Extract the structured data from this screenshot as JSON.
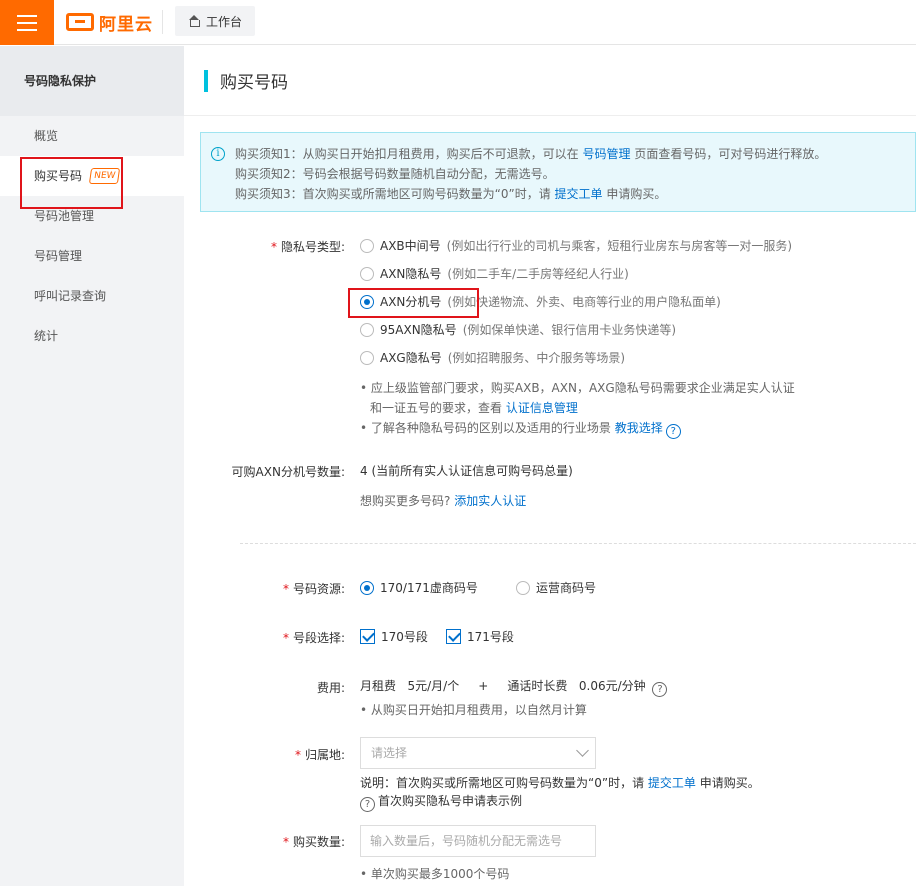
{
  "topbar": {
    "logo_text": "阿里云",
    "workbench_label": "工作台"
  },
  "sidebar": {
    "title": "号码隐私保护",
    "items": [
      {
        "label": "概览"
      },
      {
        "label": "购买号码",
        "badge": "NEW"
      },
      {
        "label": "号码池管理"
      },
      {
        "label": "号码管理"
      },
      {
        "label": "呼叫记录查询"
      },
      {
        "label": "统计"
      }
    ]
  },
  "main": {
    "page_title": "购买号码",
    "notice": {
      "line1_pre": "购买须知1：从购买日开始扣月租费用，购买后不可退款，可以在",
      "line1_link": "号码管理",
      "line1_post": "页面查看号码，可对号码进行释放。",
      "line2": "购买须知2：号码会根据号码数量随机自动分配，无需选号。",
      "line3_pre": "购买须知3：首次购买或所需地区可购号码数量为“0”时，请",
      "line3_link": "提交工单",
      "line3_post": "申请购买。"
    },
    "privacy_type": {
      "label": "隐私号类型:",
      "options": [
        {
          "name": "AXB中间号",
          "desc": "(例如出行行业的司机与乘客，短租行业房东与房客等一对一服务)",
          "checked": false
        },
        {
          "name": "AXN隐私号",
          "desc": "(例如二手车/二手房等经纪人行业)",
          "checked": false
        },
        {
          "name": "AXN分机号",
          "desc": "(例如快递物流、外卖、电商等行业的用户隐私面单)",
          "checked": true
        },
        {
          "name": "95AXN隐私号",
          "desc": "(例如保单快递、银行信用卡业务快递等)",
          "checked": false
        },
        {
          "name": "AXG隐私号",
          "desc": "(例如招聘服务、中介服务等场景)",
          "checked": false
        }
      ],
      "tip1_a": "• 应上级监管部门要求，购买AXB，AXN，AXG隐私号码需要求企业满足实人认证",
      "tip1_b": "和一证五号的要求，查看",
      "tip1_link": "认证信息管理",
      "tip2": "• 了解各种隐私号码的区别以及适用的行业场景",
      "tip2_link": "教我选择"
    },
    "available": {
      "label": "可购AXN分机号数量:",
      "value": "4 (当前所有实人认证信息可购号码总量)",
      "more": "想购买更多号码?",
      "more_link": "添加实人认证"
    },
    "resource": {
      "label": "号码资源:",
      "opt1": "170/171虚商码号",
      "opt2": "运营商码号"
    },
    "segment": {
      "label": "号段选择:",
      "opt1": "170号段",
      "opt2": "171号段"
    },
    "fee": {
      "label": "费用:",
      "monthly_label": "月租费",
      "monthly_value": "5元/月/个",
      "plus": "+",
      "call_label": "通话时长费",
      "call_value": "0.06元/分钟",
      "note": "• 从购买日开始扣月租费用，以自然月计算"
    },
    "region": {
      "label": "归属地:",
      "placeholder": "请选择",
      "note_pre": "说明：首次购买或所需地区可购号码数量为“0”时，请",
      "note_link": "提交工单",
      "note_post": "申请购买。",
      "example": "首次购买隐私号申请表示例"
    },
    "quantity": {
      "label": "购买数量:",
      "placeholder": "输入数量后，号码随机分配无需选号",
      "note": "• 单次购买最多1000个号码"
    }
  }
}
